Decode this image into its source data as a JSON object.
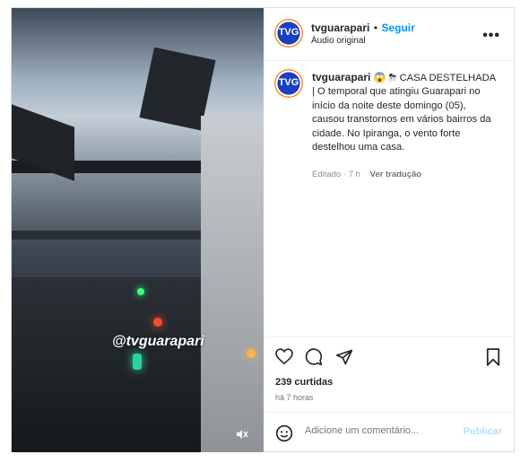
{
  "post": {
    "username": "tvguarapari",
    "dot": "•",
    "follow_label": "Seguir",
    "audio_label": "Áudio original",
    "more_icon": "more-horizontal-icon",
    "avatar_text": "TVG"
  },
  "media": {
    "watermark": "@tvguarapari",
    "mute_icon": "speaker-muted-icon"
  },
  "caption": {
    "username": "tvguarapari",
    "text": "😱 ⛈ CASA DESTELHADA | O temporal que atingiu Guarapari no início da noite deste domingo (05), causou transtornos em vários bairros da cidade. No Ipiranga, o vento forte destelhou uma casa.",
    "edited_label": "Editado",
    "age": "7 h",
    "translate_label": "Ver tradução"
  },
  "actions": {
    "like_icon": "heart-icon",
    "comment_icon": "comment-bubble-icon",
    "share_icon": "paper-plane-icon",
    "save_icon": "bookmark-icon",
    "likes_text": "239 curtidas",
    "time_text": "há 7 horas"
  },
  "comment": {
    "emoji_icon": "smiley-icon",
    "placeholder": "Adicione um comentário...",
    "publish_label": "Publicar"
  },
  "colors": {
    "accent": "#0095f6",
    "publish_disabled": "#b2dffc",
    "muted_text": "#737373"
  }
}
